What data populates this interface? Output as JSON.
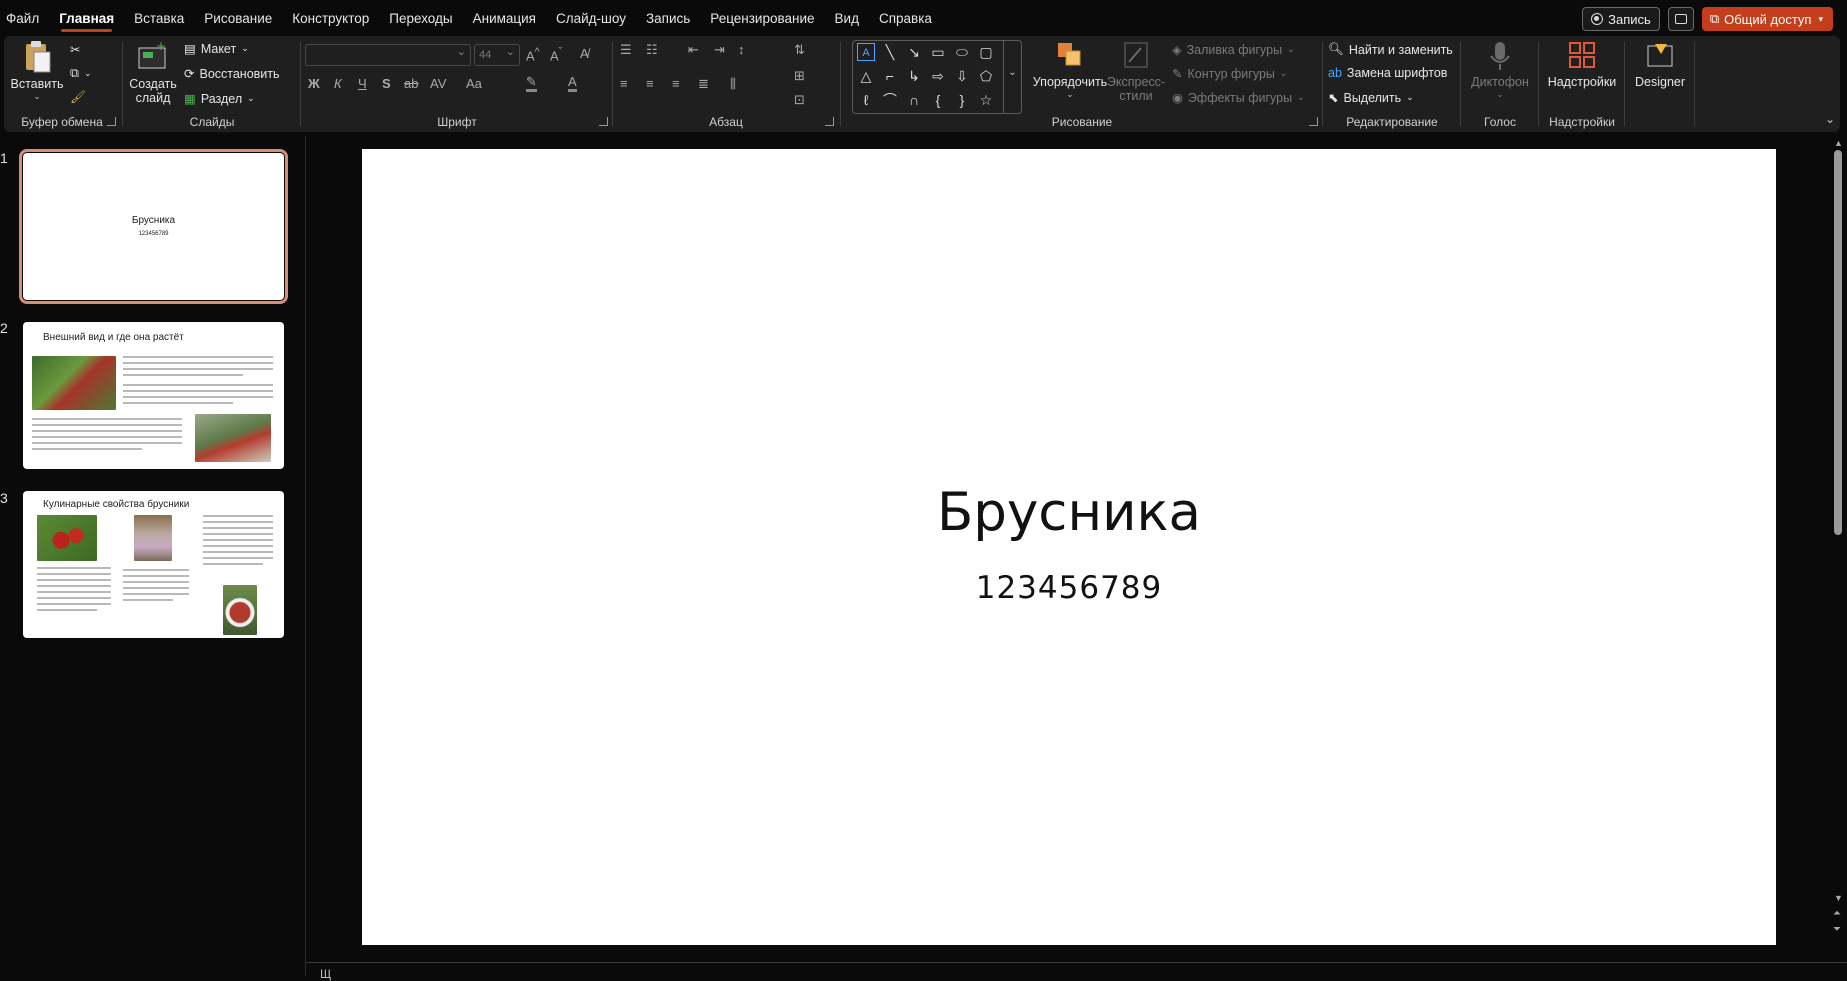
{
  "menu": {
    "tabs": [
      "Файл",
      "Главная",
      "Вставка",
      "Рисование",
      "Конструктор",
      "Переходы",
      "Анимация",
      "Слайд-шоу",
      "Запись",
      "Рецензирование",
      "Вид",
      "Справка"
    ],
    "active_tab": "Главная",
    "record_label": "Запись",
    "share_label": "Общий доступ"
  },
  "ribbon": {
    "clipboard": {
      "paste": "Вставить",
      "label": "Буфер обмена"
    },
    "slides": {
      "new_slide": "Создать слайд",
      "layout": "Макет",
      "reset": "Восстановить",
      "section": "Раздел",
      "label": "Слайды"
    },
    "font": {
      "label": "Шрифт",
      "size_placeholder": "44",
      "bold": "Ж",
      "italic": "К",
      "underline": "Ч",
      "shadow": "S",
      "strike": "ab",
      "spacing": "AV",
      "case": "Aa"
    },
    "paragraph": {
      "label": "Абзац"
    },
    "drawing": {
      "arrange": "Упорядочить",
      "quick_styles": "Экспресс-стили",
      "fill": "Заливка фигуры",
      "outline": "Контур фигуры",
      "effects": "Эффекты фигуры",
      "label": "Рисование"
    },
    "editing": {
      "find": "Найти и заменить",
      "replace_fonts": "Замена шрифтов",
      "select": "Выделить",
      "label": "Редактирование"
    },
    "voice": {
      "dictate": "Диктофон",
      "label": "Голос"
    },
    "addins": {
      "addins": "Надстройки",
      "label": "Надстройки"
    },
    "designer": {
      "label": "Designer"
    }
  },
  "thumbnails": [
    {
      "num": "1",
      "title": "Брусника",
      "subtitle": "123456789"
    },
    {
      "num": "2",
      "title": "Внешний вид и где она растёт"
    },
    {
      "num": "3",
      "title": "Кулинарные свойства брусники"
    }
  ],
  "slide": {
    "title": "Брусника",
    "subtitle": "123456789"
  },
  "notes": {
    "text": "Щ"
  },
  "colors": {
    "accent": "#c43e1c",
    "selection": "#d48f77"
  }
}
